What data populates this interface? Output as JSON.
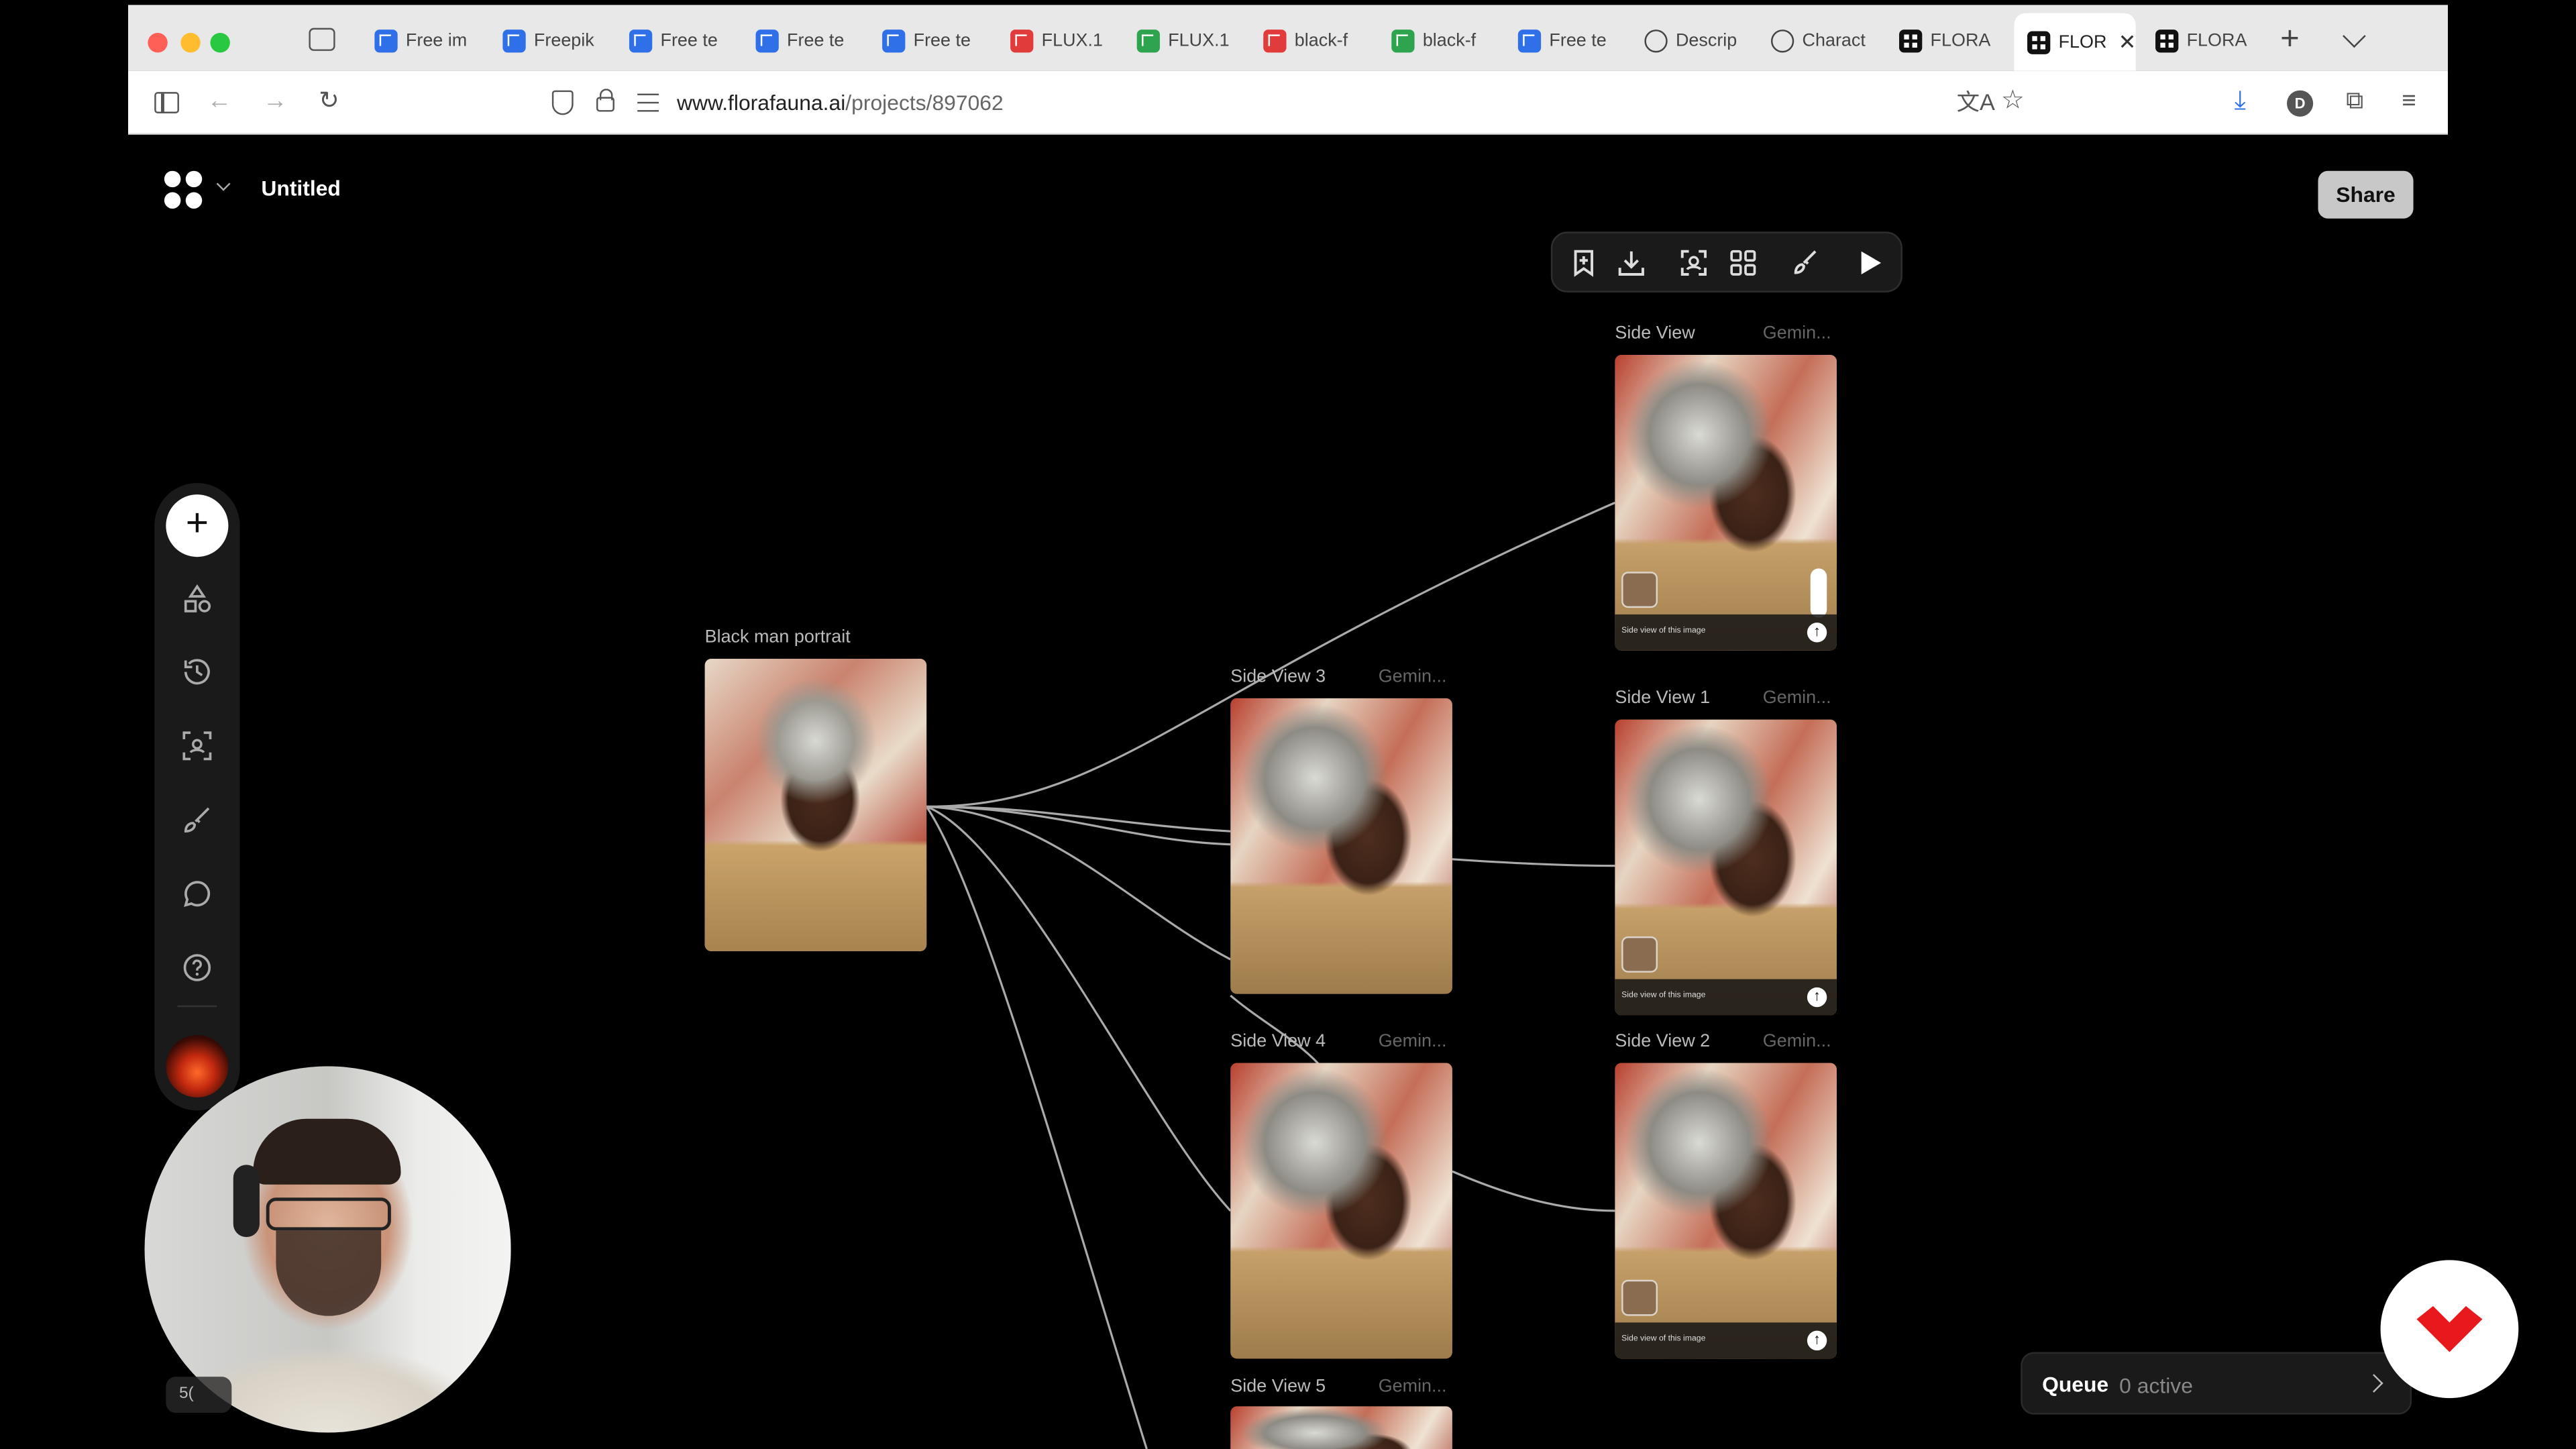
{
  "browser": {
    "tabs": [
      {
        "label": "Free im",
        "favicon": "freepik-icon"
      },
      {
        "label": "Freepik",
        "favicon": "freepik-icon"
      },
      {
        "label": "Free te",
        "favicon": "freepik-icon"
      },
      {
        "label": "Free te",
        "favicon": "freepik-icon"
      },
      {
        "label": "Free te",
        "favicon": "freepik-icon"
      },
      {
        "label": "FLUX.1",
        "favicon": "flux-red-icon"
      },
      {
        "label": "FLUX.1",
        "favicon": "flux-green-icon"
      },
      {
        "label": "black-f",
        "favicon": "flux-red-icon"
      },
      {
        "label": "black-f",
        "favicon": "flux-green-icon"
      },
      {
        "label": "Free te",
        "favicon": "freepik-icon"
      },
      {
        "label": "Descrip",
        "favicon": "openai-icon"
      },
      {
        "label": "Charact",
        "favicon": "openai-icon"
      },
      {
        "label": "FLORA",
        "favicon": "flora-icon"
      },
      {
        "label": "FLOR",
        "favicon": "flora-icon",
        "active": true
      },
      {
        "label": "FLORA",
        "favicon": "flora-icon"
      }
    ],
    "url_host": "www.florafauna.ai",
    "url_path": "/projects/897062"
  },
  "app": {
    "project_title": "Untitled",
    "share_label": "Share",
    "queue_label": "Queue",
    "queue_count": "0 active",
    "webcam_badge": "5("
  },
  "nodes": {
    "source": {
      "label": "Black man portrait"
    },
    "side_view": {
      "label": "Side View",
      "model": "Gemin...",
      "caption": "Side view of this image"
    },
    "side_view_1": {
      "label": "Side View 1",
      "model": "Gemin...",
      "caption": "Side view of this image"
    },
    "side_view_2": {
      "label": "Side View 2",
      "model": "Gemin...",
      "caption": "Side view of this image"
    },
    "side_view_3": {
      "label": "Side View 3",
      "model": "Gemin..."
    },
    "side_view_4": {
      "label": "Side View 4",
      "model": "Gemin..."
    },
    "side_view_5": {
      "label": "Side View 5",
      "model": "Gemin..."
    }
  },
  "colors": {
    "canvas_bg": "#000000",
    "panel_bg": "#1a1a1a",
    "share_bg": "#c8c8c8",
    "connector": "#bdbdbd",
    "brand_red": "#e8191d"
  }
}
